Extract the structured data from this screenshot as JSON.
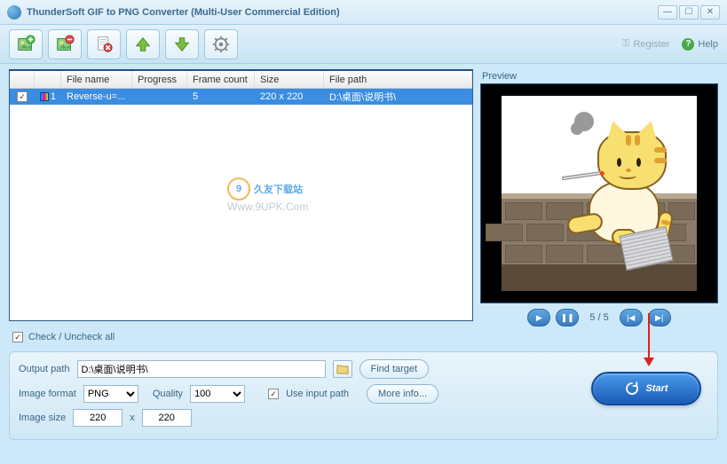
{
  "window": {
    "title": "ThunderSoft GIF to PNG Converter (Multi-User Commercial Edition)"
  },
  "toolbar": {
    "register": "Register",
    "help": "Help"
  },
  "table": {
    "headers": {
      "filename": "File name",
      "progress": "Progress",
      "framecount": "Frame count",
      "size": "Size",
      "filepath": "File path"
    },
    "rows": [
      {
        "checked": true,
        "index": "1",
        "filename": "Reverse-u=...",
        "progress": "",
        "framecount": "5",
        "size": "220 x 220",
        "filepath": "D:\\桌面\\说明书\\"
      }
    ]
  },
  "preview": {
    "label": "Preview",
    "frame_indicator": "5 / 5"
  },
  "checkall": {
    "label": "Check / Uncheck all"
  },
  "form": {
    "output_path_label": "Output path",
    "output_path_value": "D:\\桌面\\说明书\\",
    "find_target": "Find target",
    "image_format_label": "Image format",
    "image_format_value": "PNG",
    "quality_label": "Quality",
    "quality_value": "100",
    "use_input_path": "Use input path",
    "more_info": "More info...",
    "image_size_label": "Image size",
    "image_size_w": "220",
    "image_size_x": "x",
    "image_size_h": "220",
    "start": "Start"
  },
  "watermark": {
    "text": "久友下载站",
    "sub": "Www.9UPK.Com"
  }
}
